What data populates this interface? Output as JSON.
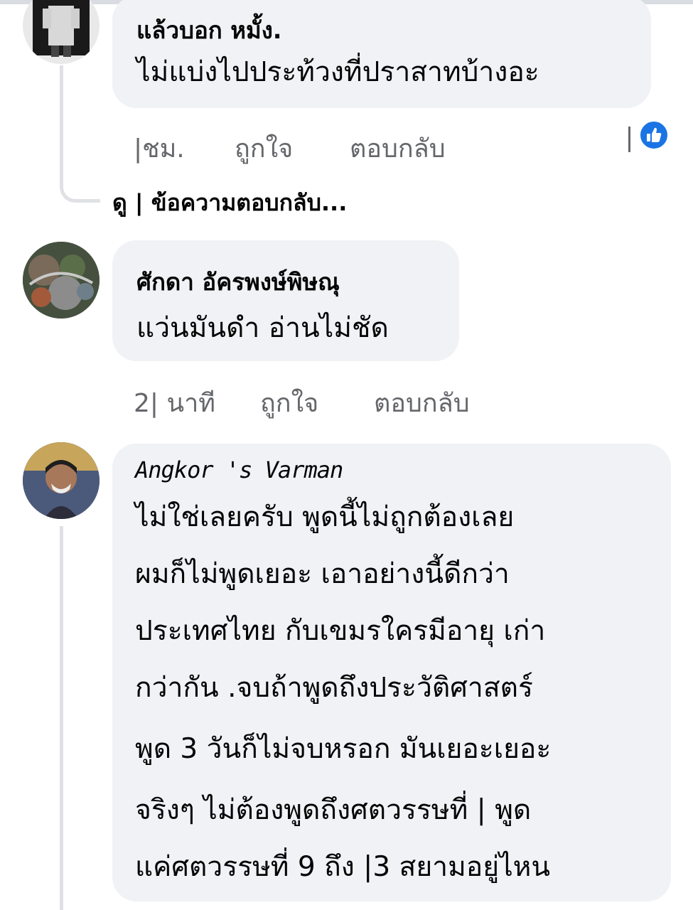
{
  "comments": [
    {
      "author": "แล้วบอก หมั้ง.",
      "text_lines": [
        "ไม่แบ่งไปประท้วงที่ปราสาทบ้างอะ"
      ],
      "time": "|ชม.",
      "like_label": "ถูกใจ",
      "reply_label": "ตอบกลับ",
      "reaction_icon": "thumbs-up-icon",
      "view_replies": "ดู | ข้อความตอบกลับ..."
    },
    {
      "author": "ศักดา อัครพงษ์พิษณุ",
      "text_lines": [
        "แว่นมันดำ อ่านไม่ชัด"
      ],
      "time": "2| นาที",
      "like_label": "ถูกใจ",
      "reply_label": "ตอบกลับ"
    },
    {
      "author": "Angkor 's Varman",
      "text_lines": [
        "ไม่ใช่เลยครับ พูดนี้ไม่ถูกต้องเลย",
        "ผมก็ไม่พูดเยอะ เอาอย่างนี้ดีกว่า",
        "ประเทศไทย กับเขมรใครมีอายุ เก่า",
        "กว่ากัน .จบถ้าพูดถึงประวัติศาสตร์",
        "พูด 3 วันก็ไม่จบหรอก มันเยอะเยอะ",
        "จริงๆ ไม่ต้องพูดถึงศตวรรษที่ | พูด",
        "แค่ศตวรรษที่ 9 ถึง |3 สยามอยู่ไหน"
      ]
    }
  ],
  "colors": {
    "bubble": "#f0f2f5",
    "meta": "#65676b",
    "like_blue": "#1b74e4",
    "thread": "#dfe1e5"
  }
}
